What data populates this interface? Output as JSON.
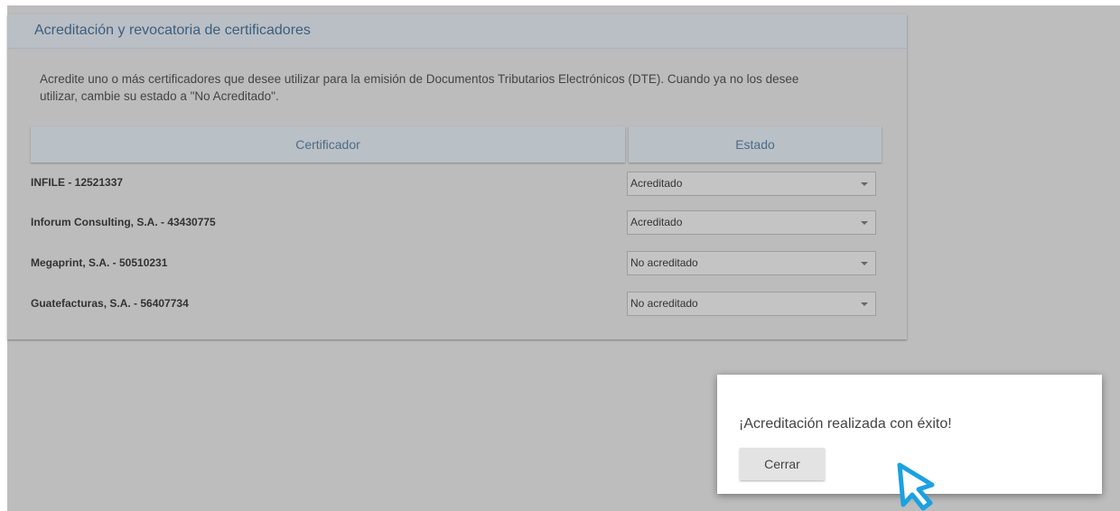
{
  "panel": {
    "title": "Acreditación y revocatoria de certificadores",
    "intro_line1": "Acredite uno o más certificadores que desee utilizar para la emisión de Documentos Tributarios Electrónicos (DTE). Cuando ya no los desee",
    "intro_line2": "utilizar, cambie su estado a \"No Acreditado\"."
  },
  "table": {
    "headers": {
      "certificador": "Certificador",
      "estado": "Estado"
    },
    "rows": [
      {
        "certificador": "INFILE - 12521337",
        "estado": "Acreditado"
      },
      {
        "certificador": "Inforum Consulting, S.A. - 43430775",
        "estado": "Acreditado"
      },
      {
        "certificador": "Megaprint, S.A. - 50510231",
        "estado": "No acreditado"
      },
      {
        "certificador": "Guatefacturas, S.A. - 56407734",
        "estado": "No acreditado"
      }
    ]
  },
  "dialog": {
    "message": "¡Acreditación realizada con éxito!",
    "close_label": "Cerrar"
  },
  "icons": {
    "cursor": "pointer-cursor-icon",
    "dropdown": "chevron-down-icon"
  },
  "colors": {
    "cursor_accent": "#1ba1e2",
    "header_text": "#3c5e7f"
  }
}
